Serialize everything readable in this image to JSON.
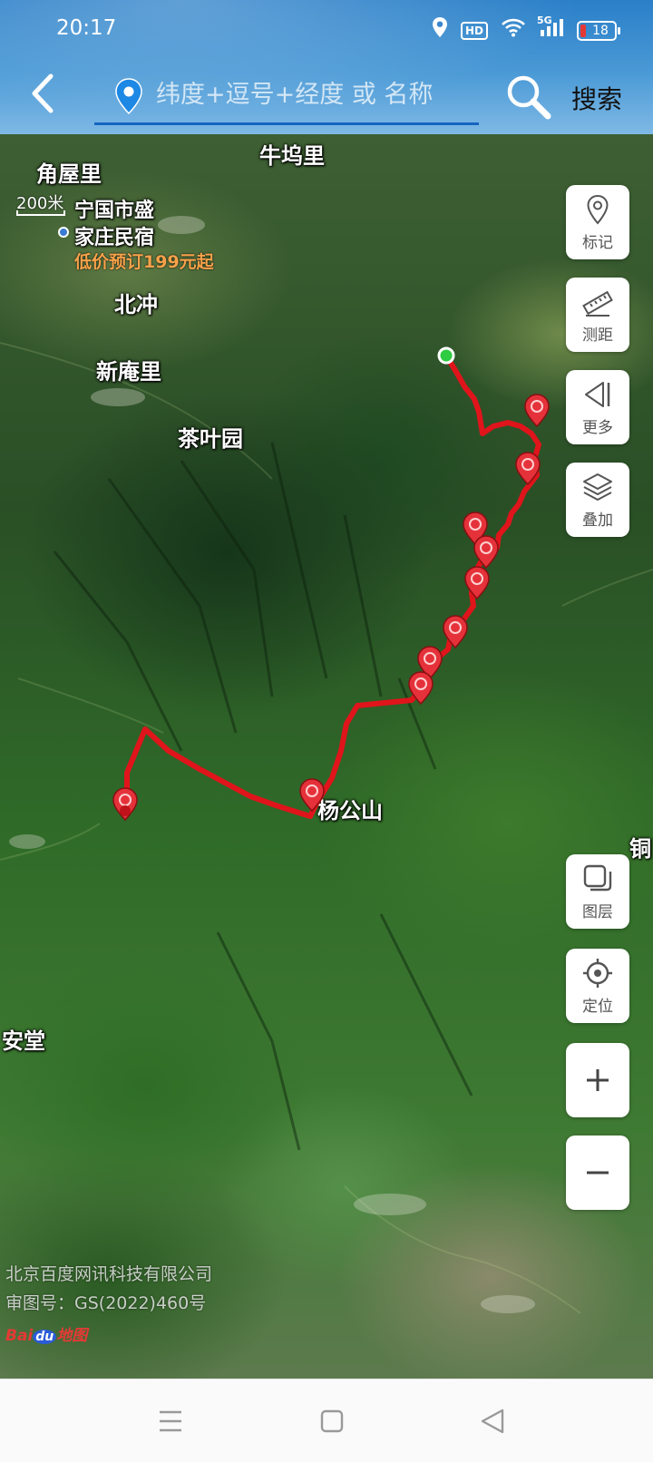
{
  "status_bar": {
    "time": "20:17",
    "network": "5G",
    "hd_badge": "HD",
    "battery_level": "18"
  },
  "header": {
    "back_icon": "chevron-left-icon",
    "search_placeholder": "纬度+逗号+经度 或 名称",
    "search_button_label": "搜索"
  },
  "map": {
    "scale_label": "200米",
    "places": [
      {
        "name": "牛坞里"
      },
      {
        "name": "角屋里"
      },
      {
        "name": "北冲"
      },
      {
        "name": "新庵里"
      },
      {
        "name": "茶叶园"
      },
      {
        "name": "杨公山"
      },
      {
        "name": "安堂"
      },
      {
        "name": "铜"
      }
    ],
    "ad": {
      "title_line1": "宁国市盛",
      "title_line2": "家庄民宿",
      "price": "低价预订199元起"
    },
    "copyright_line1": "北京百度网讯科技有限公司",
    "copyright_line2": "审图号：GS(2022)460号",
    "logo_text_1": "Bai",
    "logo_text_2": "du",
    "logo_text_3": "地图",
    "route_color": "#e0141b",
    "marker_color": "#e5323a",
    "start_marker_color": "#2ecc40"
  },
  "tools": {
    "mark": "标记",
    "measure": "测距",
    "more": "更多",
    "overlay": "叠加",
    "layers": "图层",
    "locate": "定位"
  },
  "nav": {
    "menu_icon": "menu-icon",
    "home_icon": "home-icon",
    "back_icon": "back-triangle-icon"
  }
}
